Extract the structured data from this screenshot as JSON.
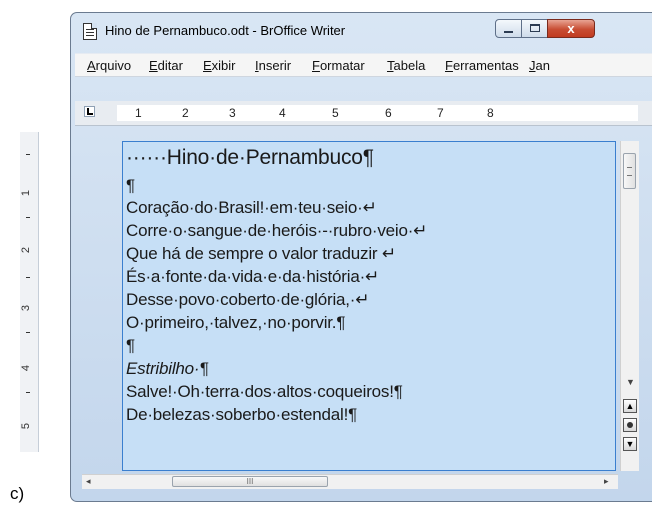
{
  "window": {
    "title": "Hino de Pernambuco.odt - BrOffice Writer",
    "buttons": {
      "minimize": "",
      "maximize": "",
      "close": "x"
    }
  },
  "menu": {
    "items": [
      "Arquivo",
      "Editar",
      "Exibir",
      "Inserir",
      "Formatar",
      "Tabela",
      "Ferramentas",
      "Jan"
    ]
  },
  "ruler": {
    "marks": [
      "1",
      "2",
      "3",
      "4",
      "5",
      "6",
      "7",
      "8"
    ],
    "vertical_marks": [
      "1",
      "2",
      "3",
      "4",
      "5"
    ]
  },
  "document": {
    "lines": [
      "······Hino·de·Pernambuco¶",
      "¶",
      "Coração·do·Brasil!·em·teu·seio·↵",
      "Corre·o·sangue·de·heróis·-·rubro·veio·↵",
      "Que há de sempre o valor traduzir ↵",
      "És·a·fonte·da·vida·e·da·história·↵",
      "Desse·povo·coberto·de·glória,·↵",
      "O·primeiro,·talvez,·no·porvir.¶",
      "¶",
      "Estribilho·¶",
      "Salve!·Oh·terra·dos·altos·coqueiros!¶",
      "De·belezas·soberbo·estendal!¶"
    ]
  },
  "scrollbars": {
    "vertical_arrow_down": "▼",
    "vertical_arrow_up": "▲",
    "hscroll_grip": "III"
  },
  "caption": "c)"
}
